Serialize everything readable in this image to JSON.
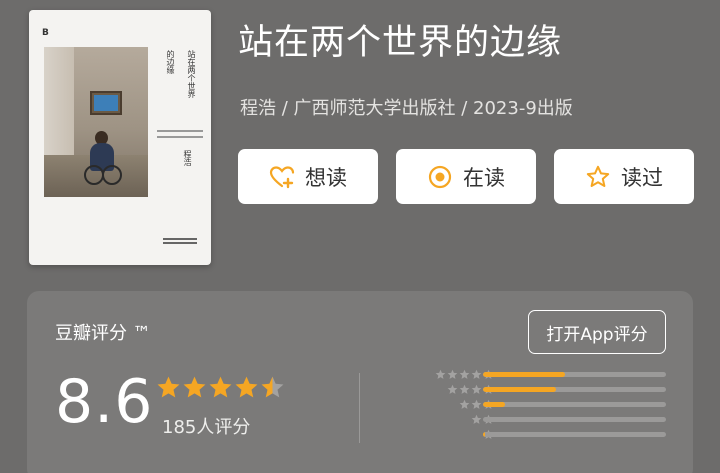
{
  "book": {
    "title": "站在两个世界的边缘",
    "meta": "程浩 / 广西师范大学出版社 / 2023-9出版",
    "cover": {
      "publisher_logo": "B",
      "title_vertical": "站在两个世界",
      "title_vertical_2": "的边缘",
      "author_vertical": "程浩"
    }
  },
  "actions": {
    "want_label": "想读",
    "reading_label": "在读",
    "read_label": "读过",
    "want_icon": "heart-plus-icon",
    "reading_icon": "target-circle-icon",
    "read_icon": "star-outline-icon",
    "accent_color": "#f5a623"
  },
  "rating": {
    "label": "豆瓣评分 ™",
    "open_app_label": "打开App评分",
    "score": "8.6",
    "stars": 4.5,
    "count": "185人评分",
    "distribution": [
      {
        "stars": 5,
        "fraction": 0.45
      },
      {
        "stars": 4,
        "fraction": 0.4
      },
      {
        "stars": 3,
        "fraction": 0.12
      },
      {
        "stars": 2,
        "fraction": 0.0
      },
      {
        "stars": 1,
        "fraction": 0.01
      }
    ],
    "star_color": "#f5a623",
    "empty_star_color": "#a3a2a1"
  }
}
